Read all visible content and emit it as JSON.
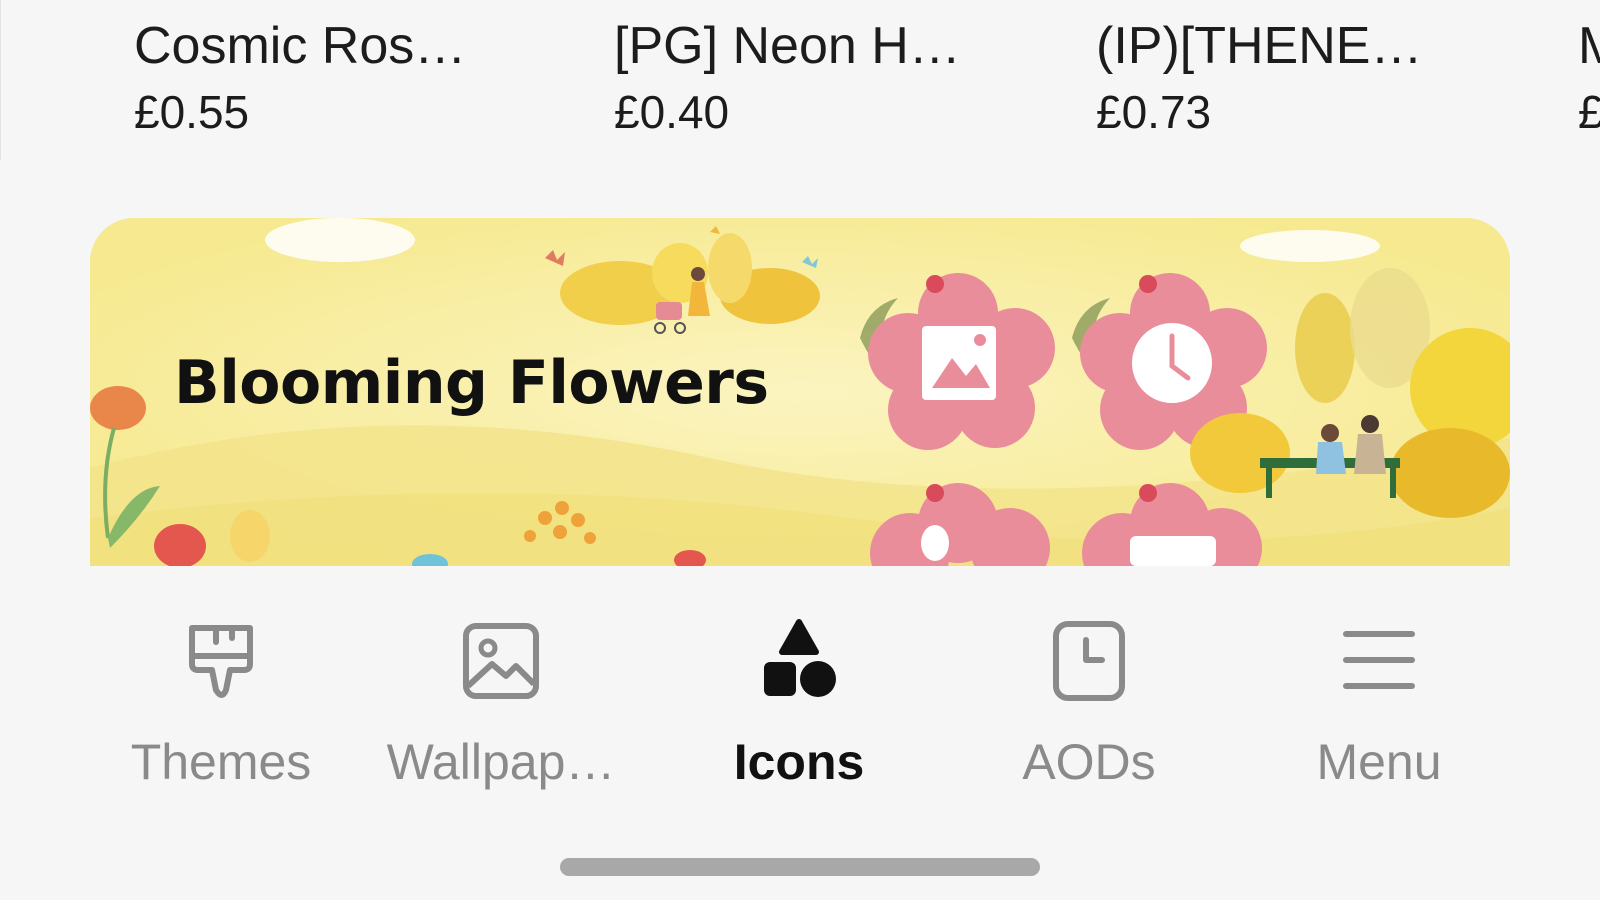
{
  "products": [
    {
      "name": "Cosmic Ros…",
      "price": "£0.55"
    },
    {
      "name": "[PG] Neon H…",
      "price": "£0.40"
    },
    {
      "name": "(IP)[THENE…",
      "price": "£0.73"
    },
    {
      "name": "M",
      "price": "£"
    }
  ],
  "banner": {
    "title": "Blooming Flowers"
  },
  "bottom_nav": {
    "items": [
      {
        "label": "Themes",
        "icon": "paintbrush-icon",
        "active": false
      },
      {
        "label": "Wallpap…",
        "icon": "image-icon",
        "active": false
      },
      {
        "label": "Icons",
        "icon": "shapes-icon",
        "active": true
      },
      {
        "label": "AODs",
        "icon": "clock-icon",
        "active": false
      },
      {
        "label": "Menu",
        "icon": "hamburger-menu-icon",
        "active": false
      }
    ]
  },
  "colors": {
    "background": "#f6f6f6",
    "banner_bg": "#f9efa5",
    "flower_pink": "#ea8d9a",
    "active_text": "#111111",
    "inactive_text": "#8a8a8a"
  }
}
